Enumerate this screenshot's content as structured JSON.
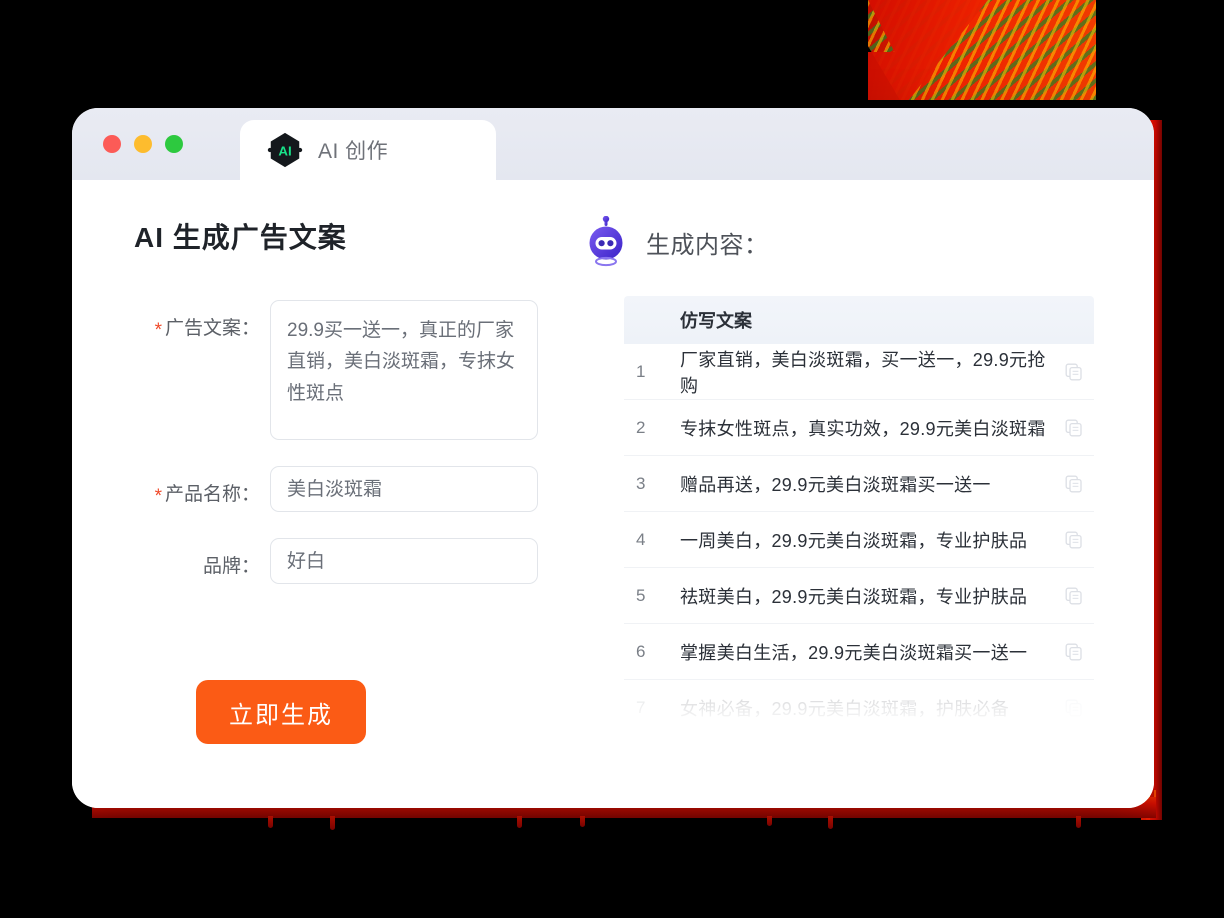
{
  "window": {
    "traffic_lights": [
      {
        "name": "close",
        "color": "#fc5b57"
      },
      {
        "name": "minimize",
        "color": "#fdbc2e"
      },
      {
        "name": "zoom",
        "color": "#2dc93f"
      }
    ],
    "tab": {
      "label": "AI 创作",
      "icon": "ai-hexagon-icon",
      "icon_text": "AI"
    }
  },
  "left_pane": {
    "title": "AI 生成广告文案",
    "fields": [
      {
        "label": "广告文案：",
        "required": true,
        "type": "textarea",
        "value": "29.9买一送一，真正的厂家直销，美白淡斑霜，专抹女性斑点"
      },
      {
        "label": "产品名称：",
        "required": true,
        "type": "input",
        "value": "美白淡斑霜"
      },
      {
        "label": "品牌：",
        "required": false,
        "type": "input",
        "value": "好白"
      }
    ],
    "submit_button": "立即生成"
  },
  "right_pane": {
    "title": "生成内容：",
    "icon": "robot-icon",
    "table": {
      "header": "仿写文案",
      "copy_icon": "copy-icon",
      "rows": [
        {
          "index": "1",
          "text": "厂家直销，美白淡斑霜，买一送一，29.9元抢购",
          "faded": false
        },
        {
          "index": "2",
          "text": "专抹女性斑点，真实功效，29.9元美白淡斑霜",
          "faded": false
        },
        {
          "index": "3",
          "text": "赠品再送，29.9元美白淡斑霜买一送一",
          "faded": false
        },
        {
          "index": "4",
          "text": "一周美白，29.9元美白淡斑霜，专业护肤品",
          "faded": false
        },
        {
          "index": "5",
          "text": "祛斑美白，29.9元美白淡斑霜，专业护肤品",
          "faded": false
        },
        {
          "index": "6",
          "text": "掌握美白生活，29.9元美白淡斑霜买一送一",
          "faded": false
        },
        {
          "index": "7",
          "text": "女神必备，29.9元美白淡斑霜，护肤必备",
          "faded": true
        }
      ]
    }
  },
  "colors": {
    "accent_orange": "#fb5b15",
    "required_star": "#f04a2a",
    "titlebar": "#e7e9f2",
    "table_header_bg": "#f2f5fa",
    "decor_red": "#ee2200",
    "robot_purple": "#5b3fe0"
  }
}
